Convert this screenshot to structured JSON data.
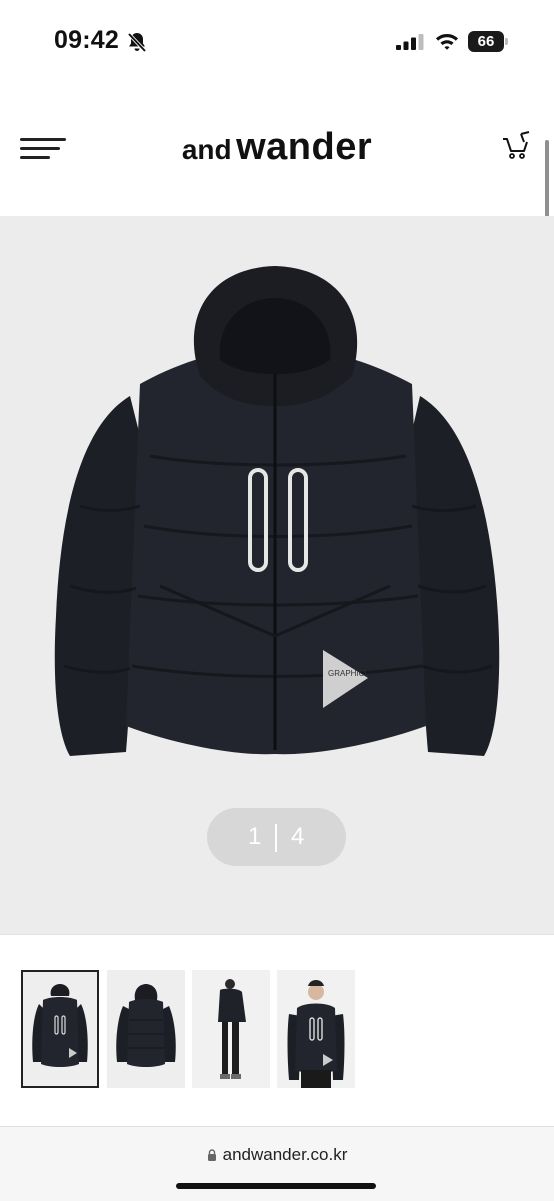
{
  "status_bar": {
    "time": "09:42",
    "battery": "66",
    "icons": [
      "bell-slash-icon",
      "signal-icon",
      "wifi-icon",
      "battery-icon"
    ]
  },
  "header": {
    "brand_small": "and",
    "brand_large": "wander",
    "menu_icon": "hamburger-menu-icon",
    "cart_icon": "shopping-cart-icon"
  },
  "product": {
    "image_pager": {
      "current": "1",
      "total": "4"
    },
    "graphic_text": "GRAPHIC!",
    "thumbnails": [
      {
        "name": "jacket-front",
        "active": true
      },
      {
        "name": "jacket-back",
        "active": false
      },
      {
        "name": "model-full-side",
        "active": false
      },
      {
        "name": "model-upper-front",
        "active": false
      }
    ]
  },
  "browser": {
    "url": "andwander.co.kr",
    "lock_icon": "lock-icon"
  },
  "colors": {
    "hero_bg": "#ececec",
    "jacket": "#20232b",
    "pager_bg": "#d7d7d7"
  }
}
